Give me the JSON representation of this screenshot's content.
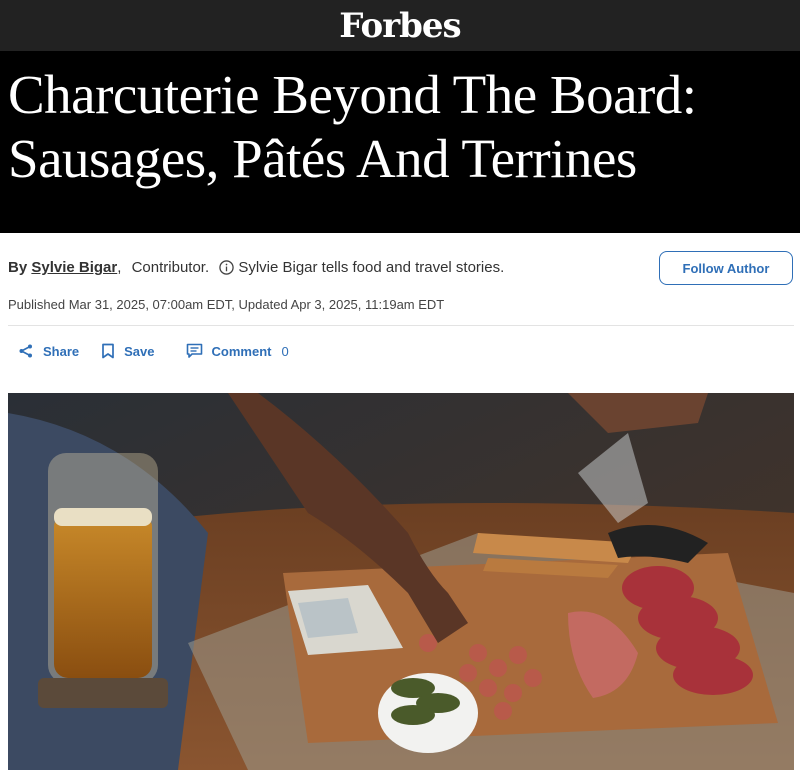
{
  "header": {
    "logo": "Forbes"
  },
  "article": {
    "headline_line1": "Charcuterie Beyond The Board:",
    "headline_line2": "Sausages, Pâtés And Terrines"
  },
  "byline": {
    "by": "By",
    "author": "Sylvie Bigar",
    "separator": ",",
    "role": "Contributor.",
    "bio": "Sylvie Bigar tells food and travel stories.",
    "follow_label": "Follow Author"
  },
  "meta": {
    "published": "Published Mar 31, 2025, 07:00am EDT, Updated Apr 3, 2025, 11:19am EDT"
  },
  "actions": {
    "share_label": "Share",
    "save_label": "Save",
    "comment_label": "Comment",
    "comment_count": "0"
  },
  "colors": {
    "accent": "#2f6fb7",
    "topbar": "#222222",
    "hero": "#000000"
  },
  "icons": [
    "share-icon",
    "bookmark-icon",
    "comment-icon",
    "info-icon"
  ]
}
